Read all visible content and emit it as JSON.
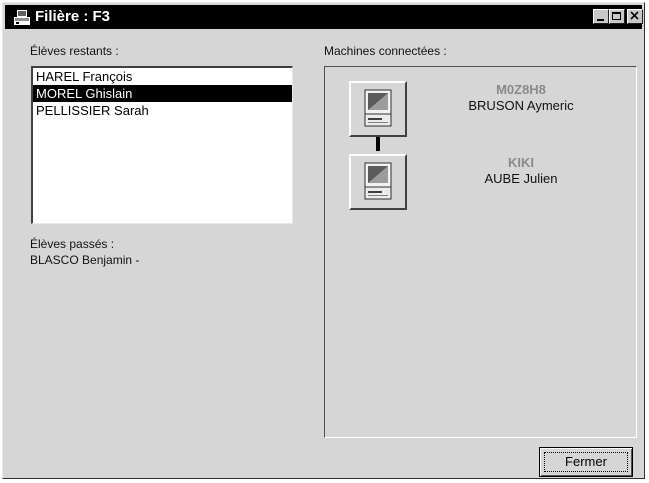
{
  "window": {
    "title": "Filière : F3",
    "buttons": [
      "minimize-icon",
      "maximize-icon",
      "close-icon"
    ]
  },
  "remaining": {
    "label": "Élèves restants :",
    "items": [
      "HAREL François",
      "MOREL Ghislain",
      "PELLISSIER Sarah"
    ],
    "selected_index": 1
  },
  "passed": {
    "label": "Élèves passés :",
    "value": "BLASCO Benjamin -"
  },
  "machines": {
    "label": "Machines connectées :",
    "items": [
      {
        "name": "M0Z8H8",
        "user": "BRUSON Aymeric",
        "icon": "computer-icon"
      },
      {
        "name": "KIKI",
        "user": "AUBE Julien",
        "icon": "computer-icon"
      }
    ]
  },
  "actions": {
    "close_label": "Fermer"
  }
}
